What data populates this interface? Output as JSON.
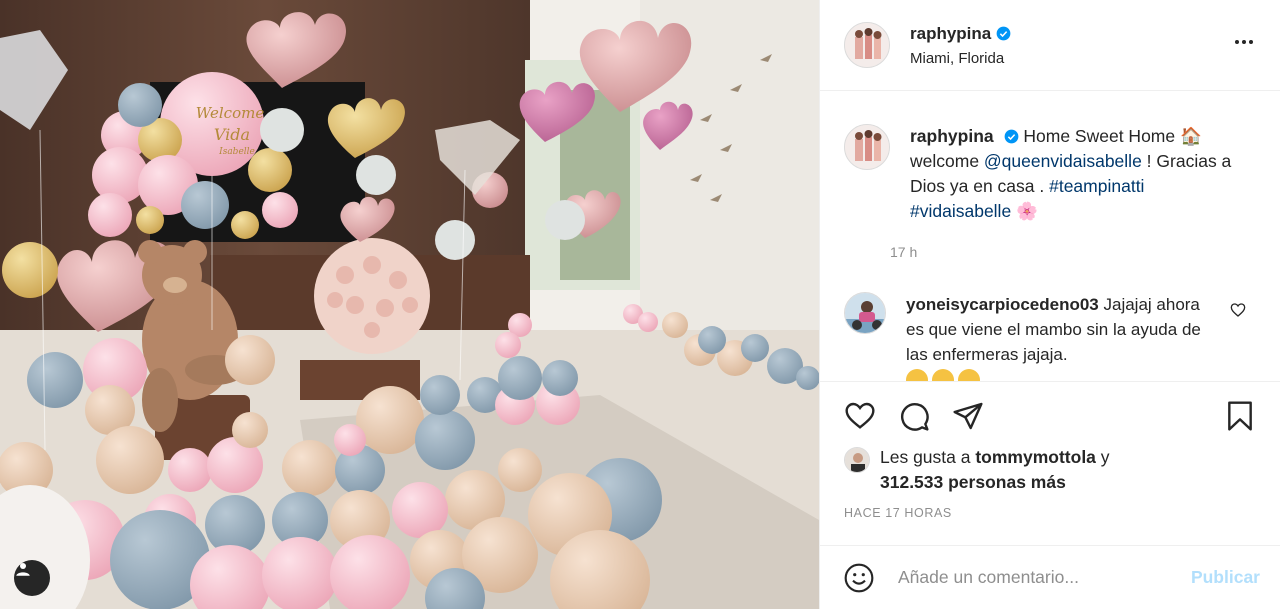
{
  "post": {
    "username": "raphypina",
    "verified": true,
    "location": "Miami, Florida",
    "more_icon": "more-options-icon",
    "balloon_text": {
      "welcome": "Welcome",
      "name": "Vida",
      "surname": "Isabelle"
    }
  },
  "caption": {
    "username": "raphypina",
    "text_1": "Home Sweet Home ",
    "emoji_1": "🏠",
    "text_2": "welcome ",
    "mention": "@queenvidaisabelle",
    "text_3": " ! Gracias a Dios ya en casa . ",
    "hashtag_1": "#teampinatti",
    "hashtag_2": "#vidaisabelle",
    "emoji_2": "🌸",
    "time": "17 h"
  },
  "comments": [
    {
      "username": "yoneisycarpiocedeno03",
      "text": " Jajajaj ahora es que viene el mambo sin la ayuda de las enfermeras jajaja."
    }
  ],
  "actions": {
    "like_icon": "heart-icon",
    "comment_icon": "comment-icon",
    "share_icon": "share-icon",
    "save_icon": "bookmark-icon"
  },
  "likes": {
    "prefix": "Les gusta a ",
    "user": "tommymottola",
    "mid": " y",
    "count": "312.533 personas más"
  },
  "timestamp": "Hace 17 horas",
  "add_comment": {
    "placeholder": "Añade un comentario...",
    "publish_label": "Publicar"
  },
  "colors": {
    "link": "#00376b",
    "verified": "#0095f6",
    "publish_disabled": "#b2dffc",
    "balloon_pink": "#f2b6c3",
    "balloon_blue": "#8fa5b5",
    "balloon_beige": "#e3c3a8"
  }
}
